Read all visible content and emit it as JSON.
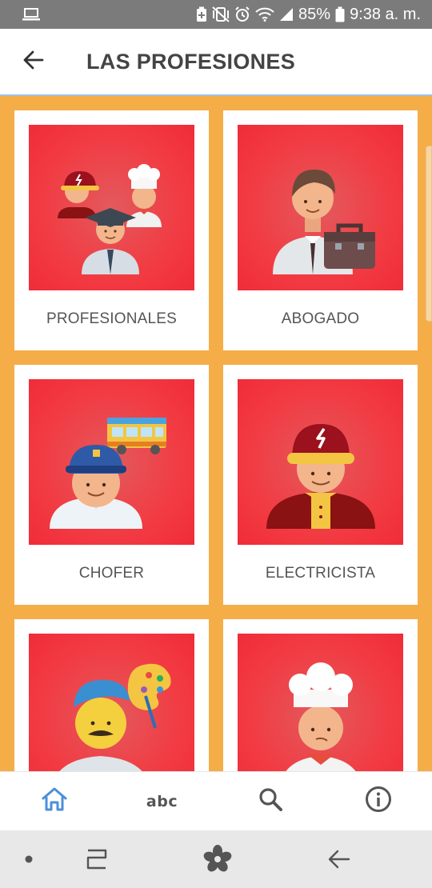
{
  "status_bar": {
    "battery": "85%",
    "time": "9:38 a. m.",
    "icons": [
      "laptop-icon",
      "battery-saver-icon",
      "vibrate-mute-icon",
      "alarm-icon",
      "wifi-icon",
      "signal-icon",
      "battery-icon"
    ]
  },
  "app_bar": {
    "title": "LAS PROFESIONES",
    "back_icon": "arrow-left-icon"
  },
  "cards": [
    {
      "label": "PROFESIONALES",
      "icon": "professionals-group-icon"
    },
    {
      "label": "ABOGADO",
      "icon": "lawyer-icon"
    },
    {
      "label": "CHOFER",
      "icon": "driver-icon"
    },
    {
      "label": "ELECTRICISTA",
      "icon": "electrician-icon"
    },
    {
      "label": "",
      "icon": "painter-icon"
    },
    {
      "label": "",
      "icon": "chef-icon"
    }
  ],
  "bottom_nav": {
    "items": [
      {
        "name": "home",
        "icon": "home-icon",
        "active": true
      },
      {
        "name": "abc",
        "text": "abc",
        "icon": "alphabet-icon"
      },
      {
        "name": "search",
        "icon": "search-icon"
      },
      {
        "name": "info",
        "icon": "info-icon"
      }
    ],
    "active_color": "#4a90d9"
  },
  "colors": {
    "background": "#f5ad48",
    "card_image": "#f02c38",
    "status_bar": "#7b7b7b",
    "app_bar": "#ffffff"
  }
}
